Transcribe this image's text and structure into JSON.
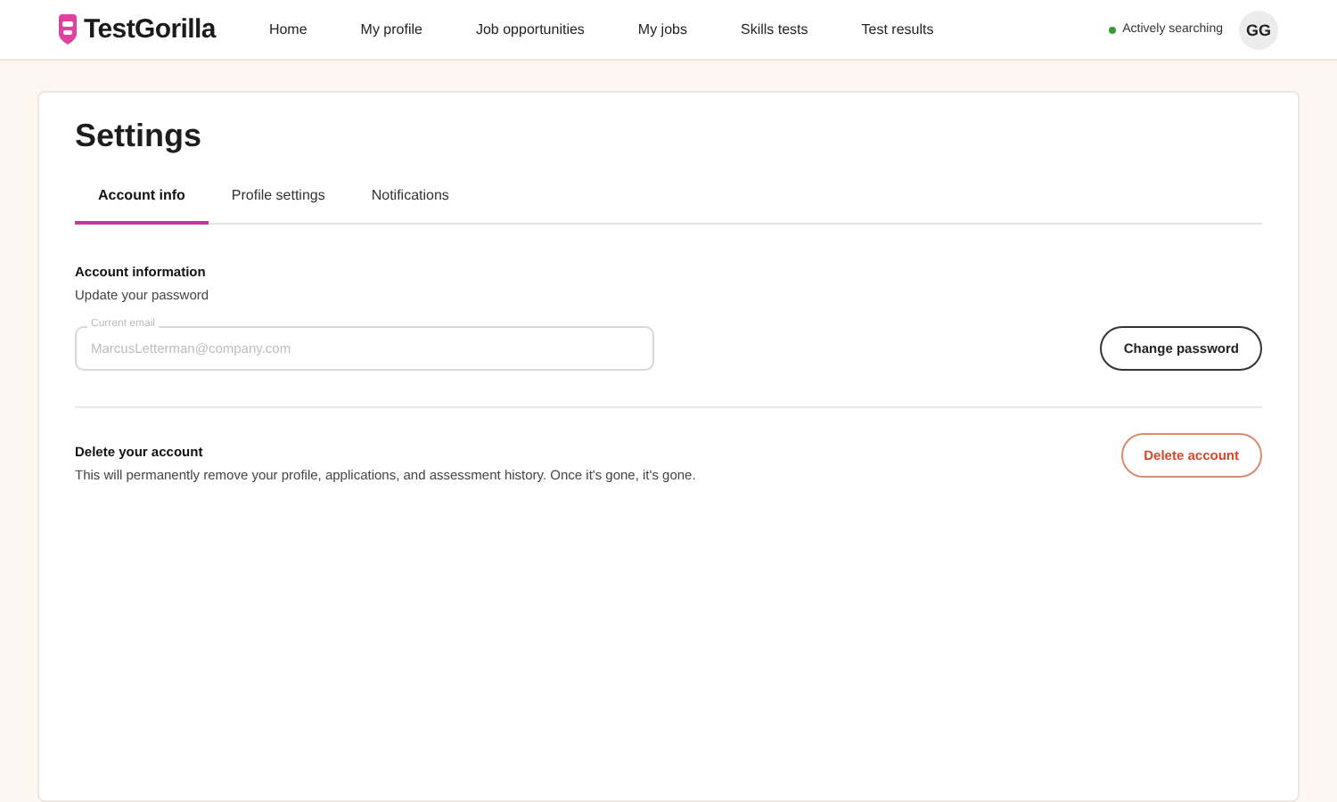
{
  "header": {
    "logo": "TestGorilla",
    "nav": [
      {
        "label": "Home",
        "selected": false
      },
      {
        "label": "My profile",
        "selected": false
      },
      {
        "label": "Job opportunities",
        "selected": false
      },
      {
        "label": "My jobs",
        "selected": false
      },
      {
        "label": "Skills tests",
        "selected": false
      },
      {
        "label": "Test results",
        "selected": false
      }
    ],
    "status": {
      "label": "Actively searching",
      "color": "#3a9a3a"
    },
    "avatar": "GG"
  },
  "settings": {
    "title": "Settings",
    "tabs": [
      {
        "label": "Account info",
        "selected": true
      },
      {
        "label": "Profile settings",
        "selected": false
      },
      {
        "label": "Notifications",
        "selected": false
      }
    ],
    "account": {
      "heading": "Account information",
      "subheading": "Update your password",
      "email_field": {
        "label": "Current email",
        "value": "MarcusLetterman@company.com",
        "disabled": true
      },
      "button": "Change password"
    },
    "delete": {
      "heading": "Delete your account",
      "description": "This will permanently remove your profile, applications, and assessment history. Once it's gone, it's gone.",
      "button": "Delete account"
    }
  }
}
